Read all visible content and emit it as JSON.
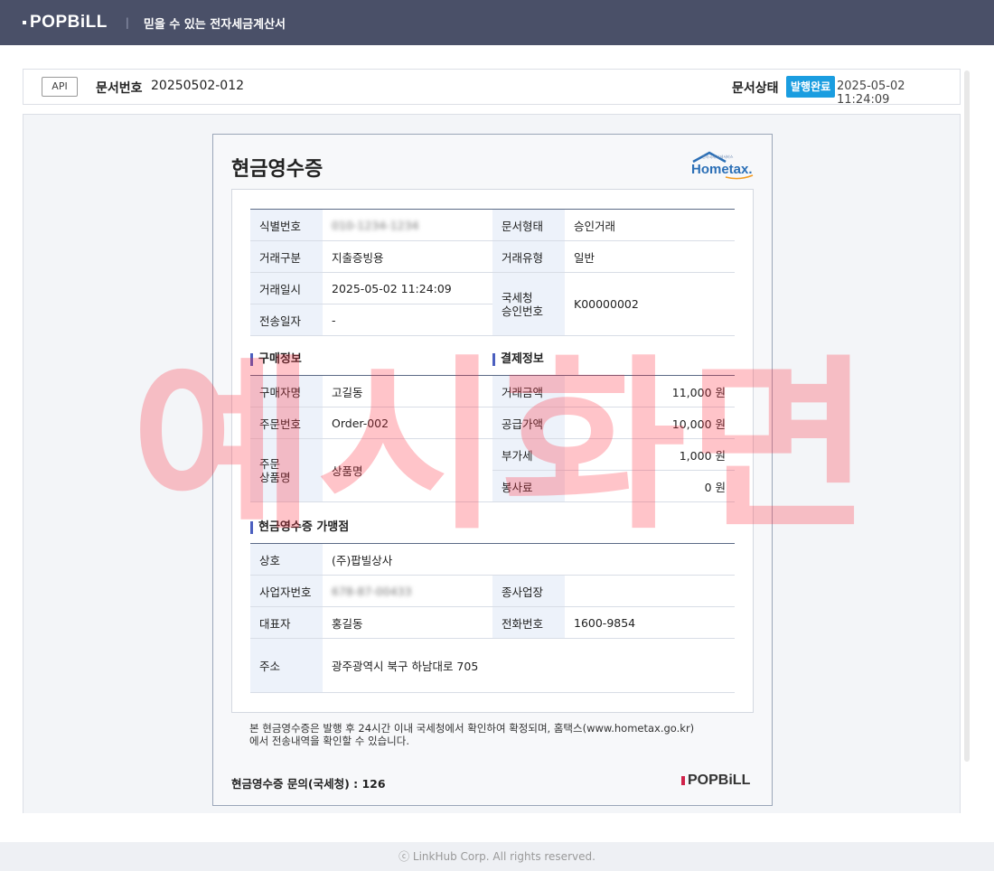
{
  "header": {
    "logo": "POPBiLL",
    "tagline": "믿을 수 있는 전자세금계산서"
  },
  "infobar": {
    "api_badge": "API",
    "doc_no_label": "문서번호",
    "doc_no": "20250502-012",
    "status_label": "문서상태",
    "status_badge": "발행완료",
    "status_time": "2025-05-02 11:24:09"
  },
  "receipt": {
    "title": "현금영수증",
    "hometax_logo_text": "Hometax.",
    "basic": {
      "id_label": "식별번호",
      "id_value": "010-1234-1234",
      "doc_type_label": "문서형태",
      "doc_type": "승인거래",
      "trade_class_label": "거래구분",
      "trade_class": "지출증빙용",
      "trade_type_label": "거래유형",
      "trade_type": "일반",
      "trade_date_label": "거래일시",
      "trade_date": "2025-05-02 11:24:09",
      "nts_label_1": "국세청",
      "nts_label_2": "승인번호",
      "nts_no": "K00000002",
      "send_date_label": "전송일자",
      "send_date": "-"
    },
    "buyer": {
      "section": "구매정보",
      "name_label": "구매자명",
      "name": "고길동",
      "order_label": "주문번호",
      "order": "Order-002",
      "item_label_1": "주문",
      "item_label_2": "상품명",
      "item": "상품명"
    },
    "payment": {
      "section": "결제정보",
      "total_label": "거래금액",
      "total": "11,000 원",
      "supply_label": "공급가액",
      "supply": "10,000 원",
      "vat_label": "부가세",
      "vat": "1,000 원",
      "service_label": "봉사료",
      "service": "0 원"
    },
    "merchant": {
      "section": "현금영수증 가맹점",
      "company_label": "상호",
      "company": "(주)팝빌상사",
      "bizno_label": "사업자번호",
      "bizno": "678-87-00433",
      "subbiz_label": "종사업장",
      "subbiz": "",
      "ceo_label": "대표자",
      "ceo": "홍길동",
      "tel_label": "전화번호",
      "tel": "1600-9854",
      "addr_label": "주소",
      "addr": "광주광역시 북구 하남대로 705"
    },
    "note_1": "본 현금영수증은 발행 후 24시간 이내 국세청에서 확인하여 확정되며, 홈택스(www.hometax.go.kr)",
    "note_2": "에서 전송내역을 확인할 수 있습니다.",
    "inquiry": "현금영수증 문의(국세청) : 126",
    "footer_logo": "POPBiLL"
  },
  "watermark": "예시화면",
  "footer": "ⓒ LinkHub Corp. All rights reserved."
}
